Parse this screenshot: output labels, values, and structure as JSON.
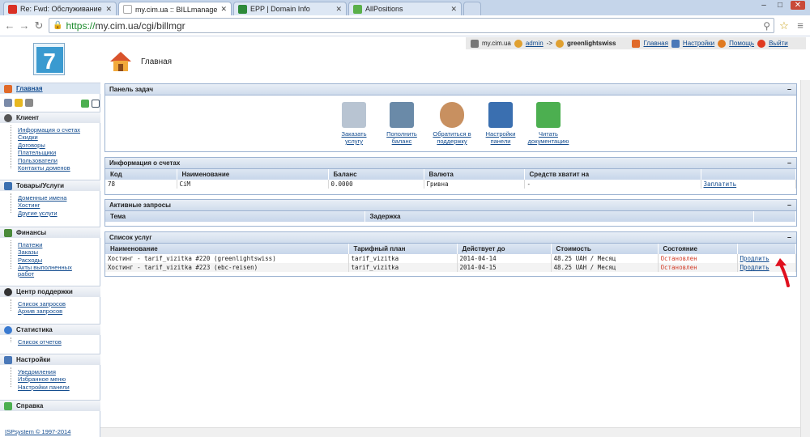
{
  "browser": {
    "tabs": [
      {
        "label": "Re: Fwd: Обслуживание"
      },
      {
        "label": "my.cim.ua :: BILLmanager"
      },
      {
        "label": "EPP | Domain Info"
      },
      {
        "label": "AllPositions"
      }
    ],
    "url_scheme": "https://",
    "url_rest": "my.cim.ua/cgi/billmgr"
  },
  "header": {
    "site": "my.cim.ua",
    "user": "admin",
    "arrow": "->",
    "account": "greenlightswiss",
    "links": {
      "home": "Главная",
      "settings": "Настройки",
      "help": "Помощь",
      "logout": "Выйти"
    }
  },
  "page": {
    "title": "Главная"
  },
  "sidebar": {
    "home": "Главная",
    "sections": [
      {
        "title": "Клиент",
        "items": [
          "Информация о счетах",
          "Скидки",
          "Договоры",
          "Плательщики",
          "Пользователи",
          "Контакты доменов"
        ]
      },
      {
        "title": "Товары/Услуги",
        "items": [
          "Доменные имена",
          "Хостинг",
          "Другие услуги"
        ]
      },
      {
        "title": "Финансы",
        "items": [
          "Платежи",
          "Заказы",
          "Расходы",
          "Акты выполненных",
          "работ"
        ]
      },
      {
        "title": "Центр поддержки",
        "items": [
          "Список запросов",
          "Архив запросов"
        ]
      },
      {
        "title": "Статистика",
        "items": [
          "Список отчетов"
        ]
      },
      {
        "title": "Настройки",
        "items": [
          "Уведомления",
          "Избранное меню",
          "Настройки панели"
        ]
      },
      {
        "title": "Справка",
        "items": []
      }
    ],
    "footer": "ISPsystem © 1997-2014"
  },
  "tasks": {
    "title": "Панель задач",
    "items": [
      {
        "line1": "Заказать",
        "line2": "услугу"
      },
      {
        "line1": "Пополнить",
        "line2": "баланс"
      },
      {
        "line1": "Обратиться в",
        "line2": "поддержку"
      },
      {
        "line1": "Настройки",
        "line2": "панели"
      },
      {
        "line1": "Читать",
        "line2": "документацию"
      }
    ]
  },
  "accounts": {
    "title": "Информация о счетах",
    "headers": [
      "Код",
      "Наименование",
      "Баланс",
      "Валюта",
      "Средств хватит на",
      ""
    ],
    "rows": [
      [
        "78",
        "CiM",
        "0.0000",
        "Гривна",
        "-",
        "Заплатить"
      ]
    ]
  },
  "requests": {
    "title": "Активные запросы",
    "headers": [
      "Тема",
      "Задержка",
      ""
    ]
  },
  "services": {
    "title": "Список услуг",
    "headers": [
      "Наименование",
      "Тарифный план",
      "Действует до",
      "Стоимость",
      "Состояние",
      ""
    ],
    "rows": [
      [
        "Хостинг - tarif_vizitka #220 (greenlightswiss)",
        "tarif_vizitka",
        "2014-04-14",
        "48.25 UAH / Месяц",
        "Остановлен",
        "Продлить"
      ],
      [
        "Хостинг - tarif_vizitka #223 (ebc-reisen)",
        "tarif_vizitka",
        "2014-04-15",
        "48.25 UAH / Месяц",
        "Остановлен",
        "Продлить"
      ]
    ]
  },
  "colors": {
    "accent": "#134c8f",
    "stopped": "#d23c28",
    "panel_border": "#9db3d1",
    "annotation_arrow": "#e0101e"
  }
}
